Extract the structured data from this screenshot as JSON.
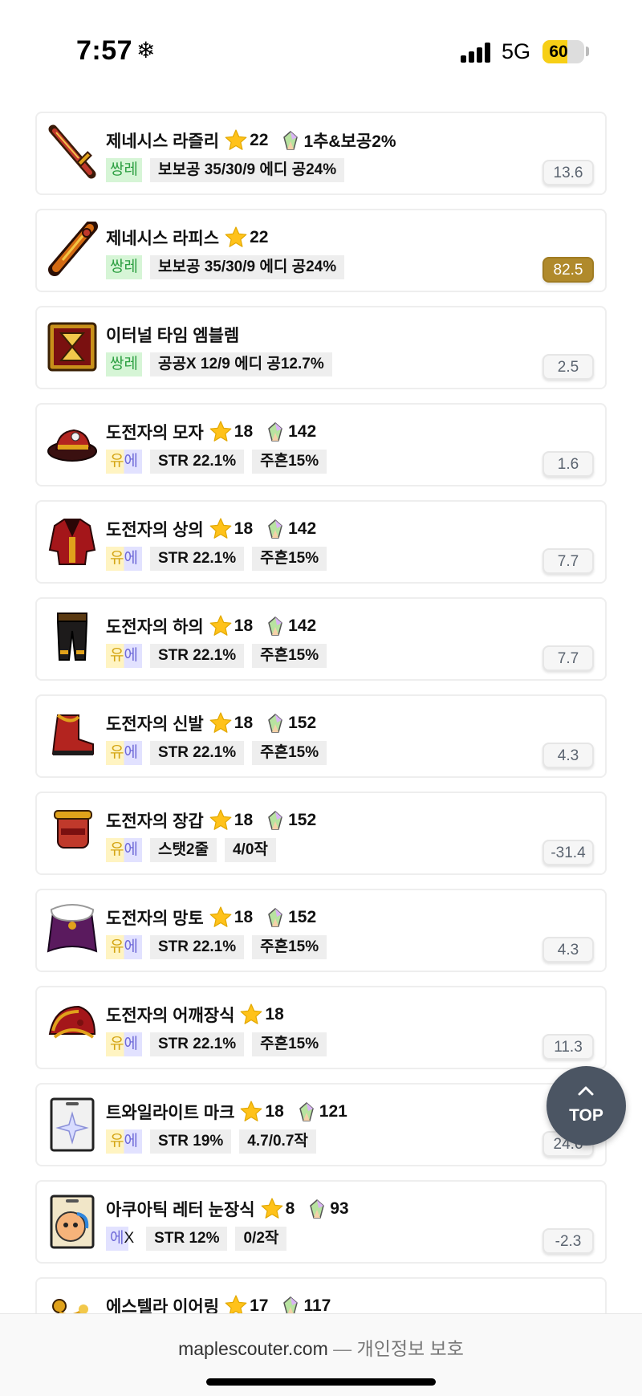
{
  "status_bar": {
    "time": "7:57",
    "weather_icon": "❄",
    "network": "5G",
    "battery": "60",
    "battery_level": 0.6
  },
  "items": [
    {
      "icon": "sword-icon",
      "name": "제네시스 라즐리",
      "star": "22",
      "potential": "1추&보공2%",
      "rank": "쌍레",
      "rank_type": "ssang",
      "tags": [
        "보보공 35/30/9 에디 공24%"
      ],
      "score": "13.6",
      "highlight": false
    },
    {
      "icon": "dagger-icon",
      "name": "제네시스 라피스",
      "star": "22",
      "potential": "",
      "rank": "쌍레",
      "rank_type": "ssang",
      "tags": [
        "보보공 35/30/9 에디 공24%"
      ],
      "score": "82.5",
      "highlight": true
    },
    {
      "icon": "emblem-icon",
      "name": "이터널 타임 엠블렘",
      "star": "",
      "potential": "",
      "rank": "쌍레",
      "rank_type": "ssang",
      "tags": [
        "공공X 12/9 에디 공12.7%"
      ],
      "score": "2.5",
      "highlight": false
    },
    {
      "icon": "hat-icon",
      "name": "도전자의 모자",
      "star": "18",
      "potential": "142",
      "rank": "유에",
      "rank_type": "u",
      "tags": [
        "STR 22.1%",
        "주흔15%"
      ],
      "score": "1.6",
      "highlight": false
    },
    {
      "icon": "top-icon",
      "name": "도전자의 상의",
      "star": "18",
      "potential": "142",
      "rank": "유에",
      "rank_type": "u",
      "tags": [
        "STR 22.1%",
        "주흔15%"
      ],
      "score": "7.7",
      "highlight": false
    },
    {
      "icon": "pants-icon",
      "name": "도전자의 하의",
      "star": "18",
      "potential": "142",
      "rank": "유에",
      "rank_type": "u",
      "tags": [
        "STR 22.1%",
        "주흔15%"
      ],
      "score": "7.7",
      "highlight": false
    },
    {
      "icon": "shoes-icon",
      "name": "도전자의 신발",
      "star": "18",
      "potential": "152",
      "rank": "유에",
      "rank_type": "u",
      "tags": [
        "STR 22.1%",
        "주흔15%"
      ],
      "score": "4.3",
      "highlight": false
    },
    {
      "icon": "gloves-icon",
      "name": "도전자의 장갑",
      "star": "18",
      "potential": "152",
      "rank": "유에",
      "rank_type": "u",
      "tags": [
        "스탯2줄",
        "4/0작"
      ],
      "score": "-31.4",
      "highlight": false
    },
    {
      "icon": "cape-icon",
      "name": "도전자의 망토",
      "star": "18",
      "potential": "152",
      "rank": "유에",
      "rank_type": "u",
      "tags": [
        "STR 22.1%",
        "주흔15%"
      ],
      "score": "4.3",
      "highlight": false
    },
    {
      "icon": "shoulder-icon",
      "name": "도전자의 어깨장식",
      "star": "18",
      "potential": "",
      "rank": "유에",
      "rank_type": "u",
      "tags": [
        "STR 22.1%",
        "주흔15%"
      ],
      "score": "11.3",
      "highlight": false
    },
    {
      "icon": "badge-icon",
      "name": "트와일라이트 마크",
      "star": "18",
      "potential": "121",
      "rank": "유에",
      "rank_type": "u",
      "tags": [
        "STR 19%",
        "4.7/0.7작"
      ],
      "score": "24.6",
      "highlight": false
    },
    {
      "icon": "eye-accessory-icon",
      "name": "아쿠아틱 레터 눈장식",
      "star": "8",
      "potential": "93",
      "rank": "에X",
      "rank_type": "e",
      "tags": [
        "STR 12%",
        "0/2작"
      ],
      "score": "-2.3",
      "highlight": false
    },
    {
      "icon": "earring-icon",
      "name": "에스텔라 이어링",
      "star": "17",
      "potential": "117",
      "rank": "",
      "rank_type": "",
      "tags": [],
      "score": "",
      "highlight": false
    }
  ],
  "top_button": {
    "label": "TOP"
  },
  "footer": {
    "site": "maplescouter.com",
    "separator": "—",
    "privacy": "개인정보 보호"
  }
}
